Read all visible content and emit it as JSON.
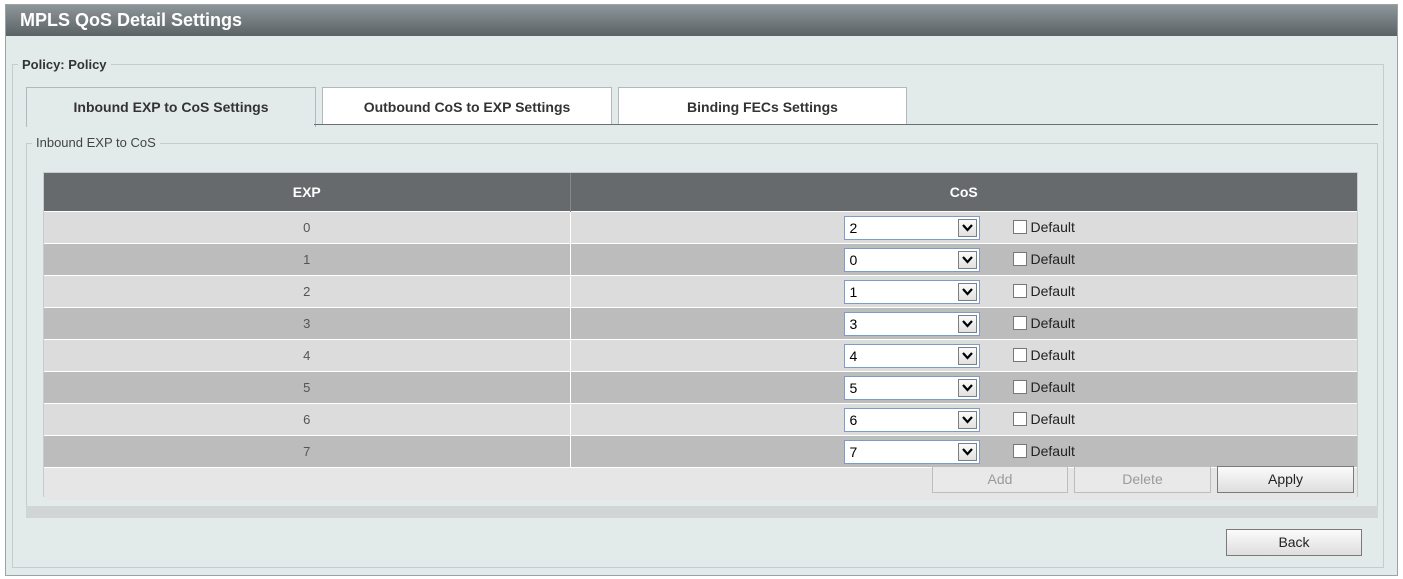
{
  "page": {
    "title": "MPLS QoS Detail Settings"
  },
  "policy": {
    "legend": "Policy: Policy"
  },
  "tabs": [
    {
      "label": "Inbound EXP to CoS Settings",
      "active": true
    },
    {
      "label": "Outbound CoS to EXP Settings",
      "active": false
    },
    {
      "label": "Binding FECs Settings",
      "active": false
    }
  ],
  "inbound": {
    "legend": "Inbound EXP to CoS",
    "columns": [
      "EXP",
      "CoS"
    ],
    "rows": [
      {
        "exp": "0",
        "cos": "2",
        "default_label": "Default",
        "default_checked": false
      },
      {
        "exp": "1",
        "cos": "0",
        "default_label": "Default",
        "default_checked": false
      },
      {
        "exp": "2",
        "cos": "1",
        "default_label": "Default",
        "default_checked": false
      },
      {
        "exp": "3",
        "cos": "3",
        "default_label": "Default",
        "default_checked": false
      },
      {
        "exp": "4",
        "cos": "4",
        "default_label": "Default",
        "default_checked": false
      },
      {
        "exp": "5",
        "cos": "5",
        "default_label": "Default",
        "default_checked": false
      },
      {
        "exp": "6",
        "cos": "6",
        "default_label": "Default",
        "default_checked": false
      },
      {
        "exp": "7",
        "cos": "7",
        "default_label": "Default",
        "default_checked": false
      }
    ],
    "buttons": {
      "add": "Add",
      "delete": "Delete",
      "apply": "Apply"
    }
  },
  "back_label": "Back"
}
